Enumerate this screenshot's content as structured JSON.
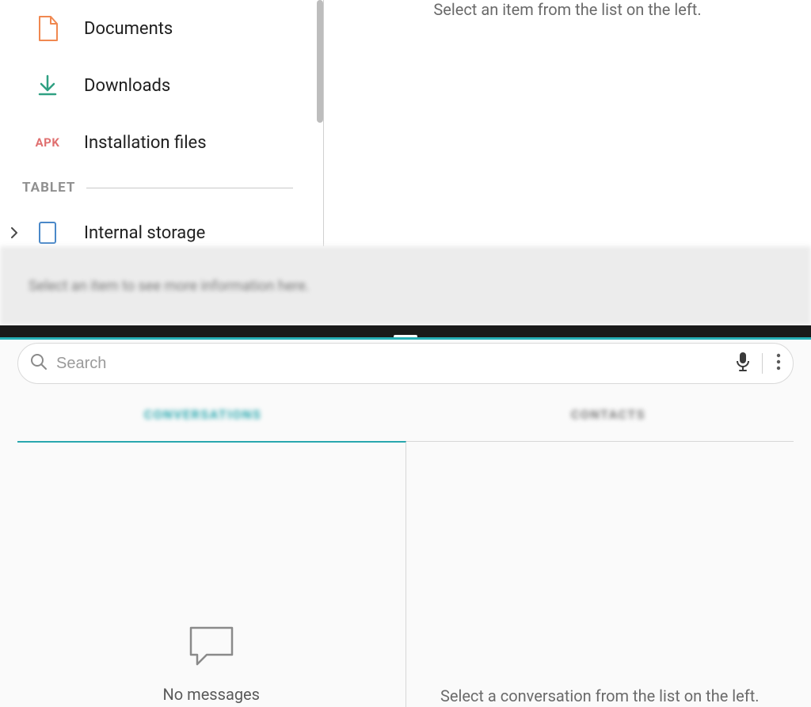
{
  "file_manager": {
    "sidebar": {
      "items": [
        {
          "label": "Documents",
          "icon": "document-icon"
        },
        {
          "label": "Downloads",
          "icon": "download-icon"
        },
        {
          "label": "Installation files",
          "icon": "apk-icon",
          "icon_text": "APK"
        }
      ],
      "section_title": "TABLET",
      "storage_label": "Internal storage"
    },
    "detail_prompt": "Select an item from the list on the left.",
    "info_bar": "Select an item to see more information here."
  },
  "messages": {
    "search_placeholder": "Search",
    "tabs": {
      "active": "CONVERSATIONS",
      "inactive": "CONTACTS"
    },
    "empty_state": "No messages",
    "right_prompt": "Select a conversation from the list on the left."
  }
}
